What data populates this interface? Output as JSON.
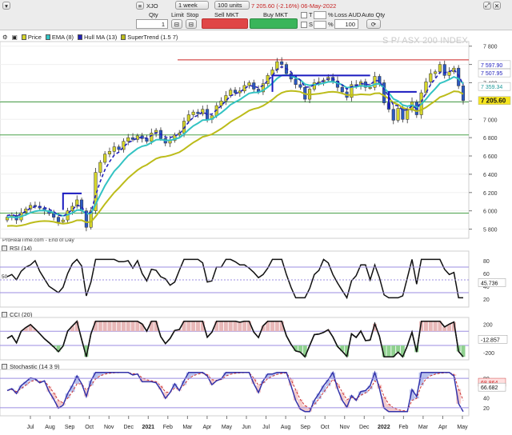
{
  "toolbar": {
    "symbol": "XJO",
    "timeframe": "1 week",
    "units": "100 units",
    "quote": "7 205.60 (-2.16%) 06-May-2022",
    "qty_label": "Qty",
    "qty_value": "1",
    "limit_label": "Limit",
    "stop_label": "Stop",
    "sell_label": "Sell MKT",
    "buy_label": "Buy MKT",
    "t_label": "T",
    "s_label": "S",
    "loss_label": "Loss AUD",
    "loss_value": "100",
    "auto_qty_label": "Auto Qty",
    "t_pct": "%",
    "s_pct": "%",
    "colors": {
      "sell": "#e04646",
      "buy": "#3ab55a"
    }
  },
  "legend": {
    "price": "Price",
    "ema": "EMA (8)",
    "hull": "Hull MA (13)",
    "supertrend": "SuperTrend (1.5 7)"
  },
  "watermark": "S P/ ASX 200 INDEX",
  "source": "ProRealTime.com - End of Day",
  "panels": {
    "rsi_title": "RSI (14)",
    "cci_title": "CCI (20)",
    "stoch_title": "Stochastic (14 3 9)",
    "rsi_left_label": "50"
  },
  "chart_data": {
    "type": "candlestick",
    "price_axis_ticks": [
      "7 800",
      "7 600",
      "7 400",
      "7 200",
      "7 000",
      "6 800",
      "6 600",
      "6 400",
      "6 200",
      "6 000",
      "5 800"
    ],
    "price_tags": {
      "supertrend": "7 597.90",
      "hull": "7 507.95",
      "ema": "7 359.34",
      "last": "7 205.60"
    },
    "h_levels": [
      7650,
      7190,
      6830,
      5975
    ],
    "rsi_ticks": [
      "80",
      "60",
      "40",
      "20"
    ],
    "rsi_value": "45.736",
    "cci_ticks": [
      "200",
      "0",
      "-200"
    ],
    "cci_value": "-12.857",
    "stoch_ticks": [
      "80",
      "60",
      "40",
      "20"
    ],
    "stoch_values": [
      "68.864",
      "66.682"
    ],
    "x_labels": [
      "Jul",
      "Aug",
      "Sep",
      "Oct",
      "Nov",
      "Dec",
      "2021",
      "Feb",
      "Mar",
      "Apr",
      "May",
      "Jun",
      "Jul",
      "Aug",
      "Sep",
      "Oct",
      "Nov",
      "Dec",
      "2022",
      "Feb",
      "Mar",
      "Apr",
      "May"
    ],
    "close": [
      5930,
      5950,
      5900,
      5980,
      6020,
      6060,
      6050,
      6030,
      6000,
      5970,
      5930,
      5880,
      5900,
      6000,
      6050,
      6120,
      6000,
      5820,
      6000,
      6420,
      6530,
      6620,
      6650,
      6700,
      6670,
      6760,
      6800,
      6780,
      6820,
      6790,
      6760,
      6850,
      6880,
      6790,
      6740,
      6770,
      6830,
      6850,
      6980,
      7050,
      7080,
      7060,
      7110,
      7000,
      7040,
      7150,
      7200,
      7260,
      7320,
      7290,
      7310,
      7370,
      7400,
      7330,
      7300,
      7390,
      7480,
      7540,
      7630,
      7600,
      7500,
      7440,
      7380,
      7350,
      7220,
      7330,
      7400,
      7410,
      7430,
      7460,
      7420,
      7350,
      7300,
      7240,
      7380,
      7360,
      7410,
      7350,
      7350,
      7470,
      7400,
      7180,
      7110,
      6990,
      7120,
      7000,
      7100,
      7190,
      7050,
      7290,
      7410,
      7500,
      7520,
      7600,
      7480,
      7520,
      7560,
      7366,
      7206
    ]
  },
  "colors": {
    "bull": "#d4d42a",
    "bear": "#2b59c3",
    "ema": "#33c3c3",
    "hull": "#2222bb",
    "supertrend_up": "#bcbc1a",
    "supertrend_down": "#1a1ac0",
    "red_level": "#cc2222",
    "green_level": "#4aa14a",
    "osc_line": "#111111"
  }
}
